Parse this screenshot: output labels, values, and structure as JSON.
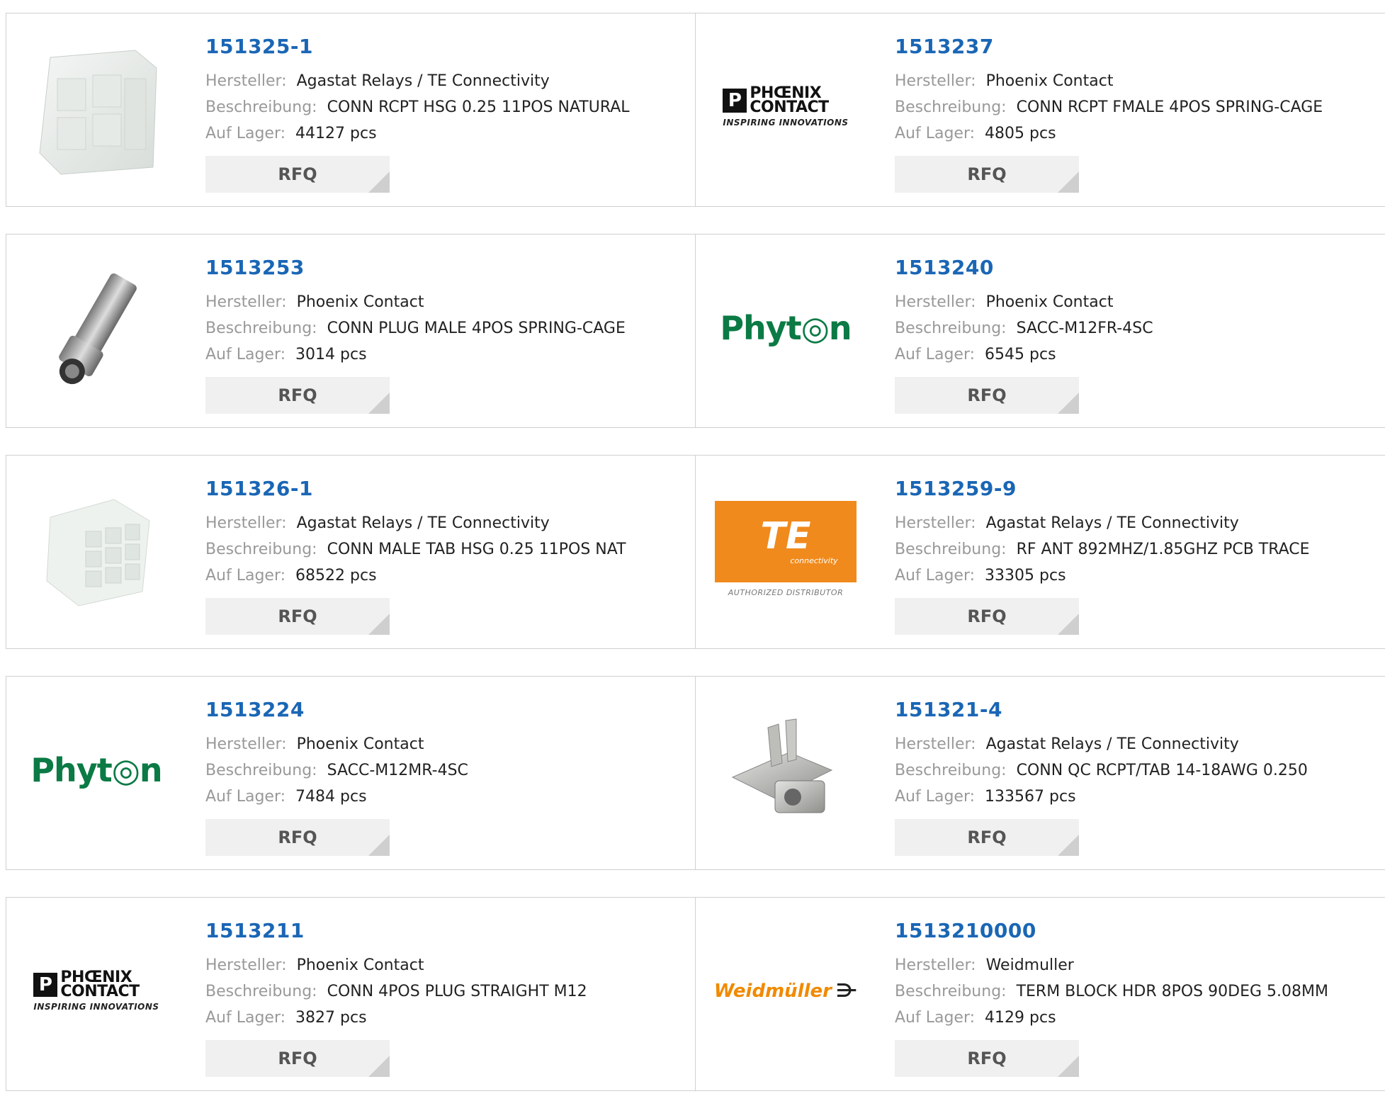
{
  "labels": {
    "manufacturer": "Hersteller:",
    "description": "Beschreibung:",
    "stock": "Auf Lager:",
    "rfq": "RFQ"
  },
  "products": [
    {
      "part": "151325-1",
      "manufacturer": "Agastat Relays / TE Connectivity",
      "description": "CONN RCPT HSG 0.25 11POS NATURAL",
      "stock": "44127 pcs",
      "image": "white-connector-housing"
    },
    {
      "part": "1513237",
      "manufacturer": "Phoenix Contact",
      "description": "CONN RCPT FMALE 4POS SPRING-CAGE",
      "stock": "4805 pcs",
      "image": "phoenix-contact-logo",
      "logo": {
        "l1": "PHŒNIX",
        "l2": "CONTACT",
        "tag": "INSPIRING INNOVATIONS"
      }
    },
    {
      "part": "1513253",
      "manufacturer": "Phoenix Contact",
      "description": "CONN PLUG MALE 4POS SPRING-CAGE",
      "stock": "3014 pcs",
      "image": "m12-plug-photo"
    },
    {
      "part": "1513240",
      "manufacturer": "Phoenix Contact",
      "description": "SACC-M12FR-4SC",
      "stock": "6545 pcs",
      "image": "phyton-logo",
      "logo": {
        "text": "Phyt◎n"
      }
    },
    {
      "part": "151326-1",
      "manufacturer": "Agastat Relays / TE Connectivity",
      "description": "CONN MALE TAB HSG 0.25 11POS NAT",
      "stock": "68522 pcs",
      "image": "white-tab-housing"
    },
    {
      "part": "1513259-9",
      "manufacturer": "Agastat Relays / TE Connectivity",
      "description": "RF ANT 892MHZ/1.85GHZ PCB TRACE",
      "stock": "33305 pcs",
      "image": "te-connectivity-logo",
      "logo": {
        "big": "TE",
        "small": "connectivity",
        "auth": "AUTHORIZED DISTRIBUTOR"
      }
    },
    {
      "part": "1513224",
      "manufacturer": "Phoenix Contact",
      "description": "SACC-M12MR-4SC",
      "stock": "7484 pcs",
      "image": "phyton-logo",
      "logo": {
        "text": "Phyt◎n"
      }
    },
    {
      "part": "151321-4",
      "manufacturer": "Agastat Relays / TE Connectivity",
      "description": "CONN QC RCPT/TAB 14-18AWG 0.250",
      "stock": "133567 pcs",
      "image": "metal-terminal-photo"
    },
    {
      "part": "1513211",
      "manufacturer": "Phoenix Contact",
      "description": "CONN 4POS PLUG STRAIGHT M12",
      "stock": "3827 pcs",
      "image": "phoenix-contact-logo",
      "logo": {
        "l1": "PHŒNIX",
        "l2": "CONTACT",
        "tag": "INSPIRING INNOVATIONS"
      }
    },
    {
      "part": "1513210000",
      "manufacturer": "Weidmuller",
      "description": "TERM BLOCK HDR 8POS 90DEG 5.08MM",
      "stock": "4129 pcs",
      "image": "weidmuller-logo",
      "logo": {
        "text": "Weidmüller",
        "mark": "⋺"
      }
    }
  ]
}
